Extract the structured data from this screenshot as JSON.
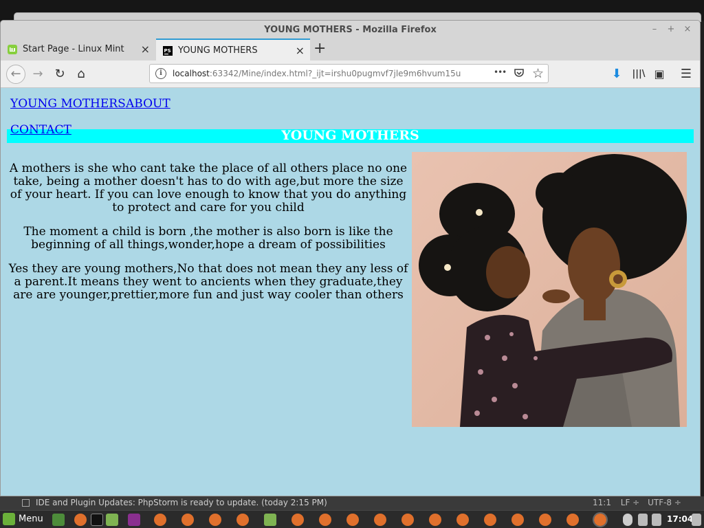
{
  "window": {
    "title": "YOUNG MOTHERS - Mozilla Firefox",
    "minimize": "–",
    "maximize": "+",
    "close": "×"
  },
  "tabs": [
    {
      "label": "Start Page - Linux Mint",
      "icon": "linux-mint-icon",
      "close": "×"
    },
    {
      "label": "YOUNG MOTHERS",
      "icon": "phpstorm-icon",
      "close": "×",
      "active": true
    }
  ],
  "new_tab": "+",
  "toolbar": {
    "back": "←",
    "forward": "→",
    "reload": "↻",
    "home": "⌂",
    "url_host": "localhost",
    "url_rest": ":63342/Mine/index.html?_ijt=irshu0pugmvf7jle9m6hvum15u",
    "info": "i",
    "more": "•••",
    "download": "⬇",
    "library": "|||\\",
    "sidebar": "▣",
    "menu": "☰"
  },
  "page": {
    "nav": {
      "home": "YOUNG MOTHERS",
      "about": "ABOUT",
      "contact": "CONTACT"
    },
    "header_title": "YOUNG MOTHERS",
    "paragraphs": [
      "A mothers is she who cant take the place of all others place no one take, being a mother doesn't has to do with age,but more the size of your heart. If you can love enough to know that you do anything to protect and care for you child",
      "The moment a child is born ,the mother is also born is like the beginning of all things,wonder,hope a dream of possibilities",
      "Yes they are young mothers,No that does not mean they any less of a parent.It means they went to ancients when they graduate,they are are younger,prettier,more fun and just way cooler than others"
    ],
    "colors": {
      "background": "#add8e6",
      "header_band": "#00ffff",
      "link": "#0000ee"
    }
  },
  "statusbar": {
    "message": "IDE and Plugin Updates: PhpStorm is ready to update. (today 2:15 PM)",
    "position": "11:1",
    "line_ending": "LF ÷",
    "encoding": "UTF-8 ÷"
  },
  "taskbar": {
    "menu_label": "Menu",
    "clock": "17:04"
  }
}
